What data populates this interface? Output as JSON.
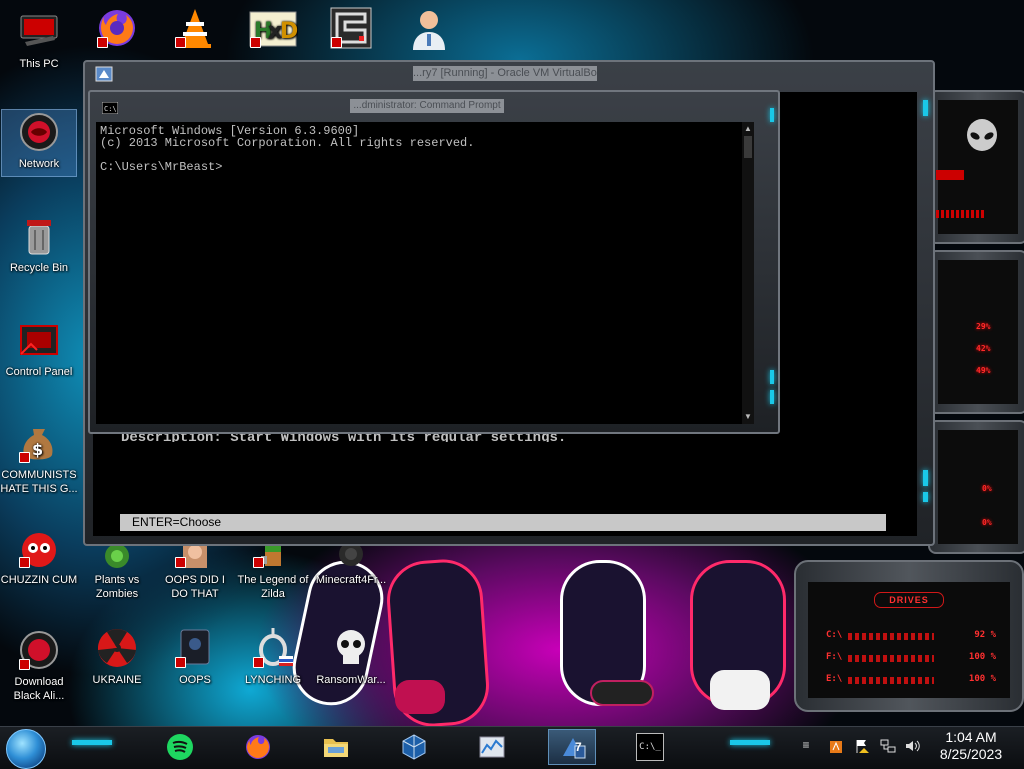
{
  "desktop": {
    "icons": [
      {
        "label": "This PC"
      },
      {
        "label": "Network"
      },
      {
        "label": "Recycle Bin"
      },
      {
        "label": "Control Panel"
      },
      {
        "label": "COMMUNISTS HATE THIS G..."
      },
      {
        "label": "CHUZZIN CUM"
      },
      {
        "label": "Plants vs Zombies"
      },
      {
        "label": "OOPS DID I DO THAT"
      },
      {
        "label": "The Legend of Zilda"
      },
      {
        "label": "Minecraft4Fr..."
      },
      {
        "label": "Download Black Ali..."
      },
      {
        "label": "UKRAINE"
      },
      {
        "label": "OOPS"
      },
      {
        "label": "LYNCHING"
      },
      {
        "label": "RansomWar..."
      }
    ],
    "top_icons": [
      {
        "icon": "firefox-icon"
      },
      {
        "icon": "vlc-icon"
      },
      {
        "icon": "hxd-icon"
      },
      {
        "icon": "maze-app-icon"
      },
      {
        "icon": "doctor-icon"
      }
    ]
  },
  "vbox_window": {
    "title": "...ry7 [Running] - Oracle VM VirtualBox",
    "background_line": "Description: Start Windows with its regular settings.",
    "status_bar": "ENTER=Choose"
  },
  "cmd_window": {
    "title": "...dministrator: Command Prompt",
    "lines": [
      "Microsoft Windows [Version 6.3.9600]",
      "(c) 2013 Microsoft Corporation. All rights reserved.",
      "",
      "C:\\Users\\MrBeast>"
    ]
  },
  "gadgets": {
    "cpu_percent_labels": [
      "29%",
      "42%",
      "49%"
    ],
    "net_percent_labels": [
      "0%",
      "0%"
    ],
    "drives": {
      "header": "DRIVES",
      "rows": [
        {
          "label": "C:\\",
          "percent": "92 %"
        },
        {
          "label": "F:\\",
          "percent": "100 %"
        },
        {
          "label": "E:\\",
          "percent": "100 %"
        }
      ]
    }
  },
  "taskbar": {
    "apps": [
      {
        "icon": "spotify-icon"
      },
      {
        "icon": "firefox-icon"
      },
      {
        "icon": "file-explorer-icon"
      },
      {
        "icon": "virtualbox-icon"
      },
      {
        "icon": "task-manager-icon"
      },
      {
        "icon": "windows7-vm-icon"
      },
      {
        "icon": "command-prompt-icon"
      }
    ],
    "cmd_glyph": "C:\\_",
    "vm_badge": "7",
    "tray_icons": [
      "keyboard-icon",
      "volume-icon",
      "network-icon",
      "flag-icon",
      "battery-icon"
    ],
    "time": "1:04 AM",
    "date": "8/25/2023"
  },
  "colors": {
    "accent_cyan": "#1ac8e8",
    "alienware_red": "#ff2a2a",
    "terminal_text": "#c0c0c0"
  }
}
